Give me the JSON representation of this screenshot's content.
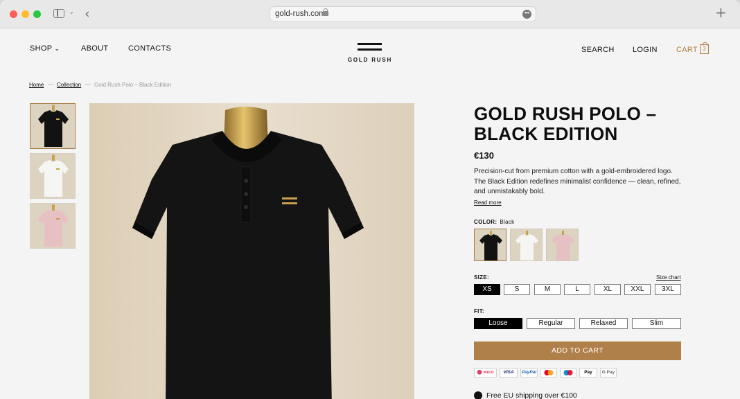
{
  "browser": {
    "url": "gold-rush.com"
  },
  "header": {
    "nav_left": [
      "SHOP",
      "ABOUT",
      "CONTACTS"
    ],
    "logo_text": "GOLD RUSH",
    "nav_right": [
      "SEARCH",
      "LOGIN",
      "CART"
    ],
    "cart_count": "3",
    "accent_color": "#b07d3f"
  },
  "breadcrumb": {
    "items": [
      "Home",
      "Collection"
    ],
    "current": "Gold Rush Polo – Black Edition"
  },
  "product": {
    "title": "GOLD RUSH POLO – BLACK EDITION",
    "price": "€130",
    "description": "Precision-cut from premium cotton with a gold-embroidered logo. The Black Edition redefines minimalist confidence — clean, refined, and unmistakably bold.",
    "read_more": "Read more",
    "color_label": "COLOR:",
    "color_value": "Black",
    "colors": [
      {
        "name": "black",
        "hex": "#111111",
        "selected": true
      },
      {
        "name": "white",
        "hex": "#f4f4f2",
        "selected": false
      },
      {
        "name": "pink",
        "hex": "#e6c0c3",
        "selected": false
      }
    ],
    "size_label": "SIZE:",
    "size_chart": "Size chart",
    "sizes": [
      "XS",
      "S",
      "M",
      "L",
      "XL",
      "XXL",
      "3XL"
    ],
    "selected_size": "XS",
    "fit_label": "FIT:",
    "fits": [
      "Loose",
      "Regular",
      "Relaxed",
      "Slim"
    ],
    "selected_fit": "Loose",
    "add_to_cart": "ADD TO CART",
    "payment_methods": [
      "Klarna-wero",
      "VISA",
      "PayPal",
      "Mastercard",
      "Maestro",
      "Apple Pay",
      "G Pay"
    ],
    "shipping": "Free EU shipping over €100"
  }
}
